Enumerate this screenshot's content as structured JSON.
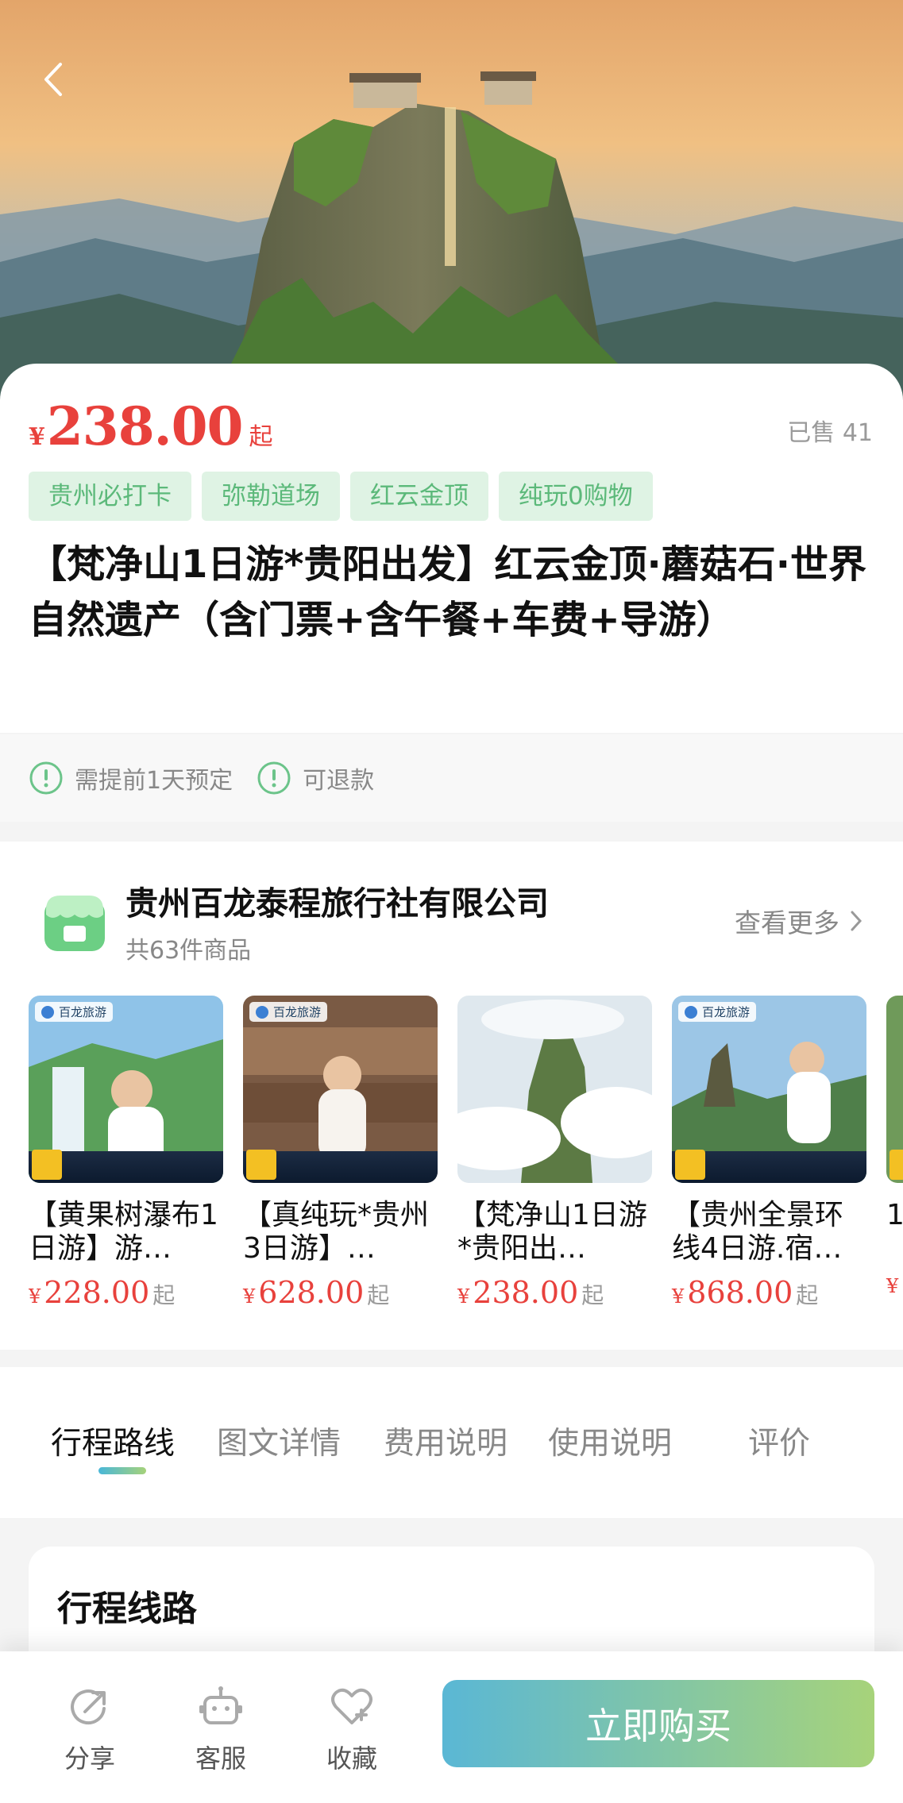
{
  "hero": {
    "back_icon": "chevron-left-icon"
  },
  "price": {
    "currency": "¥",
    "value": "238.00",
    "suffix": "起"
  },
  "sold": "已售 41",
  "tags": [
    "贵州必打卡",
    "弥勒道场",
    "红云金顶",
    "纯玩0购物"
  ],
  "title": "【梵净山1日游*贵阳出发】红云金顶·蘑菇石·世界自然遗产（含门票+含午餐+车费+导游）",
  "notices": [
    {
      "icon": "alert-circle-icon",
      "label": "需提前1天预定"
    },
    {
      "icon": "alert-circle-icon",
      "label": "可退款"
    }
  ],
  "shop": {
    "name": "贵州百龙泰程旅行社有限公司",
    "count": "共63件商品",
    "see_more": "查看更多",
    "products": [
      {
        "name": "【黄果树瀑布1日游】游…",
        "currency": "¥",
        "price": "228.00",
        "suffix": "起",
        "label": "百龙旅游"
      },
      {
        "name": "【真纯玩*贵州3日游】…",
        "currency": "¥",
        "price": "628.00",
        "suffix": "起",
        "label": "百龙旅游"
      },
      {
        "name": "【梵净山1日游*贵阳出…",
        "currency": "¥",
        "price": "238.00",
        "suffix": "起",
        "label": ""
      },
      {
        "name": "【贵州全景环线4日游.宿…",
        "currency": "¥",
        "price": "868.00",
        "suffix": "起",
        "label": "百龙旅游"
      },
      {
        "name": "1",
        "currency": "¥",
        "price": "",
        "suffix": "",
        "label": ""
      }
    ]
  },
  "tabs": [
    "行程路线",
    "图文详情",
    "费用说明",
    "使用说明",
    "评价"
  ],
  "active_tab": "行程路线",
  "itinerary": {
    "title": "行程线路"
  },
  "bottombar": {
    "share": "分享",
    "service": "客服",
    "favorite": "收藏",
    "buy": "立即购买"
  },
  "colors": {
    "price": "#e8413c",
    "tag_bg": "#dff3e4",
    "tag_text": "#5cb97a",
    "accent_start": "#5ab7d5",
    "accent_end": "#a7d37a"
  }
}
